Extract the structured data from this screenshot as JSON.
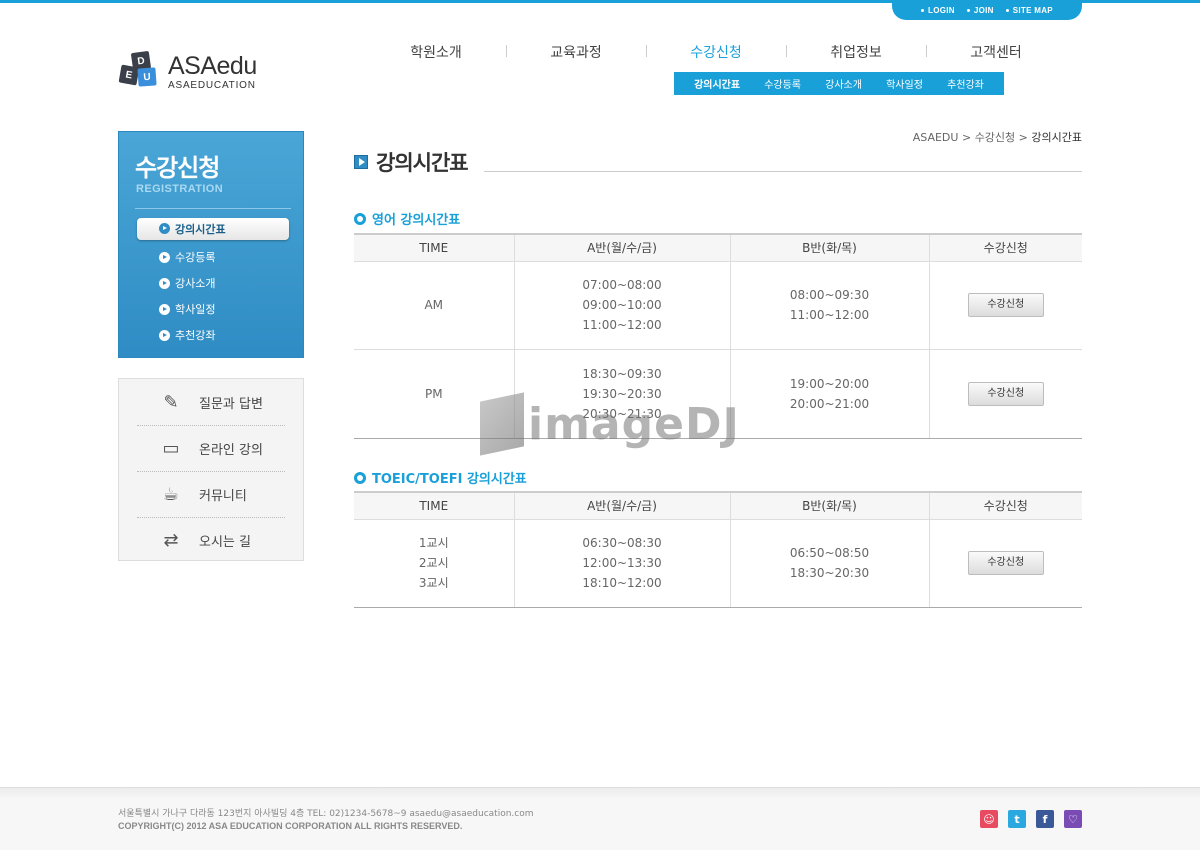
{
  "util_links": [
    "LOGIN",
    "JOIN",
    "SITE MAP"
  ],
  "logo": {
    "letters": [
      "D",
      "E",
      "U"
    ],
    "brand": "ASAedu",
    "sub": "ASAEDUCATION"
  },
  "gnb": [
    {
      "label": "학원소개",
      "active": false
    },
    {
      "label": "교육과정",
      "active": false
    },
    {
      "label": "수강신청",
      "active": true
    },
    {
      "label": "취업정보",
      "active": false
    },
    {
      "label": "고객센터",
      "active": false
    }
  ],
  "lnb": [
    "강의시간표",
    "수강등록",
    "강사소개",
    "학사일정",
    "추천강좌"
  ],
  "side": {
    "title": "수강신청",
    "eng": "REGISTRATION",
    "menu": [
      "강의시간표",
      "수강등록",
      "강사소개",
      "학사일정",
      "추천강좌"
    ]
  },
  "quick": [
    {
      "label": "질문과 답변",
      "icon": "qna-icon"
    },
    {
      "label": "온라인 강의",
      "icon": "online-lecture-icon"
    },
    {
      "label": "커뮤니티",
      "icon": "community-icon"
    },
    {
      "label": "오시는 길",
      "icon": "directions-icon"
    }
  ],
  "breadcrumb": [
    "ASAEDU",
    "수강신청",
    "강의시간표"
  ],
  "page_title": "강의시간표",
  "english_table": {
    "title": "영어 강의시간표",
    "headers": [
      "TIME",
      "A반(월/수/금)",
      "B반(화/목)",
      "수강신청"
    ],
    "rows": [
      {
        "time": "AM",
        "a": [
          "07:00~08:00",
          "09:00~10:00",
          "11:00~12:00"
        ],
        "b": [
          "08:00~09:30",
          "11:00~12:00"
        ],
        "btn": "수강신청"
      },
      {
        "time": "PM",
        "a": [
          "18:30~09:30",
          "19:30~20:30",
          "20:30~21:30"
        ],
        "b": [
          "19:00~20:00",
          "20:00~21:00"
        ],
        "btn": "수강신청"
      }
    ]
  },
  "toeic_table": {
    "title": "TOEIC/TOEFI 강의시간표",
    "headers": [
      "TIME",
      "A반(월/수/금)",
      "B반(화/목)",
      "수강신청"
    ],
    "rows": [
      {
        "time": [
          "1교시",
          "2교시",
          "3교시"
        ],
        "a": [
          "06:30~08:30",
          "12:00~13:30",
          "18:10~12:00"
        ],
        "b": [
          "06:50~08:50",
          "18:30~20:30"
        ],
        "btn": "수강신청"
      }
    ]
  },
  "watermark": "imageDJ",
  "footer": {
    "address": "서울특별시 가나구 다라동 123번지 아사빌딩 4층    TEL: 02)1234-5678~9    asaedu@asaeducation.com",
    "copyright": "COPYRIGHT(C) 2012 ASA EDUCATION CORPORATION ALL RIGHTS RESERVED.",
    "sns": [
      {
        "name": "me2day-icon",
        "color": "#e84a5f",
        "glyph": "☺"
      },
      {
        "name": "twitter-icon",
        "color": "#29a9df",
        "glyph": "t"
      },
      {
        "name": "facebook-icon",
        "color": "#3b5998",
        "glyph": "f"
      },
      {
        "name": "yozm-icon",
        "color": "#7b4bb5",
        "glyph": "♡"
      }
    ]
  },
  "colors": {
    "accent": "#1aa0d8",
    "side_bg": "#2f8cc4"
  }
}
